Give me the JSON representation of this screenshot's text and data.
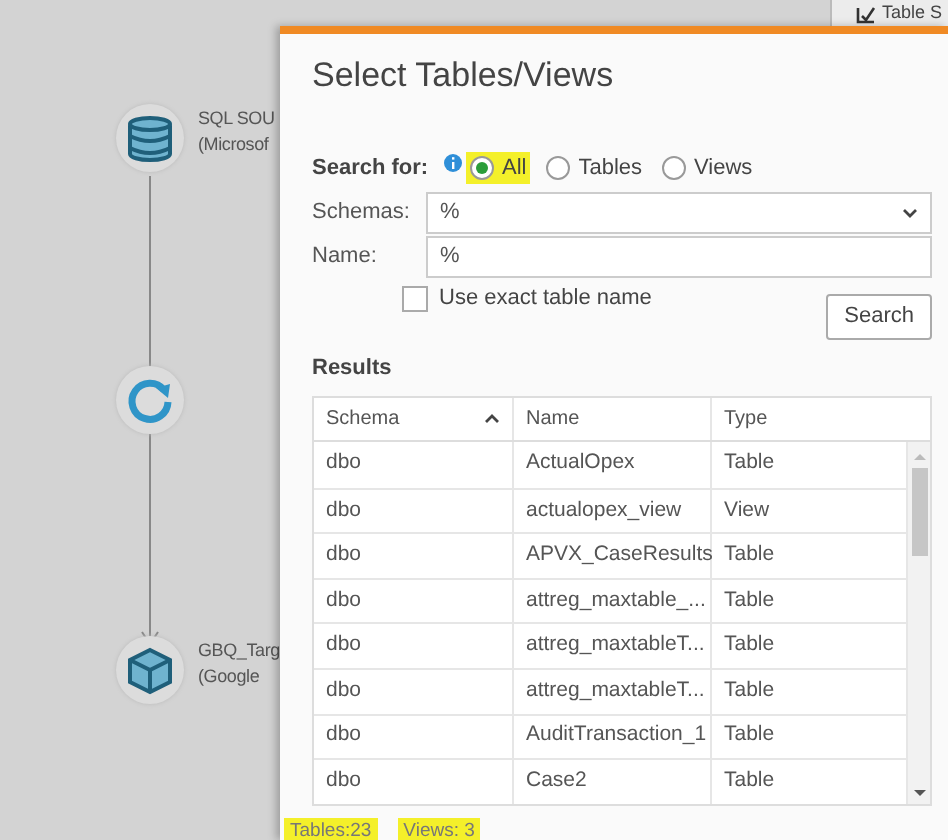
{
  "canvas": {
    "nodes": [
      {
        "kind": "database",
        "lines": [
          "SQL SOU",
          "(Microsof"
        ]
      },
      {
        "kind": "transform"
      },
      {
        "kind": "target",
        "lines": [
          "GBQ_Targ",
          "(Google"
        ]
      }
    ],
    "background_panel": {
      "title": "Table S"
    }
  },
  "dialog": {
    "title": "Select Tables/Views",
    "search_for": {
      "label": "Search for:",
      "options": [
        {
          "label": "All",
          "selected": true,
          "color": "#f4f02a"
        },
        {
          "label": "Tables",
          "selected": false
        },
        {
          "label": "Views",
          "selected": false
        }
      ]
    },
    "schemas": {
      "label": "Schemas:",
      "value": "%"
    },
    "name": {
      "label": "Name:",
      "value": "%"
    },
    "exact_name": {
      "label": "Use exact table name",
      "checked": false
    },
    "search_button": "Search",
    "results_label": "Results",
    "table": {
      "columns": [
        {
          "label": "Schema",
          "sorted": true
        },
        {
          "label": "Name",
          "sorted": false
        },
        {
          "label": "Type",
          "sorted": false
        }
      ],
      "rows": [
        [
          "dbo",
          "ActualOpex",
          "Table"
        ],
        [
          "dbo",
          "actualopex_view",
          "View"
        ],
        [
          "dbo",
          "APVX_CaseResults",
          "Table"
        ],
        [
          "dbo",
          "attreg_maxtable_...",
          "Table"
        ],
        [
          "dbo",
          "attreg_maxtableT...",
          "Table"
        ],
        [
          "dbo",
          "attreg_maxtableT...",
          "Table"
        ],
        [
          "dbo",
          "AuditTransaction_1",
          "Table"
        ],
        [
          "dbo",
          "Case2",
          "Table"
        ]
      ]
    },
    "footer": {
      "color": "#f4f02a",
      "counts": [
        "Tables:23",
        "Views: 3"
      ]
    }
  }
}
